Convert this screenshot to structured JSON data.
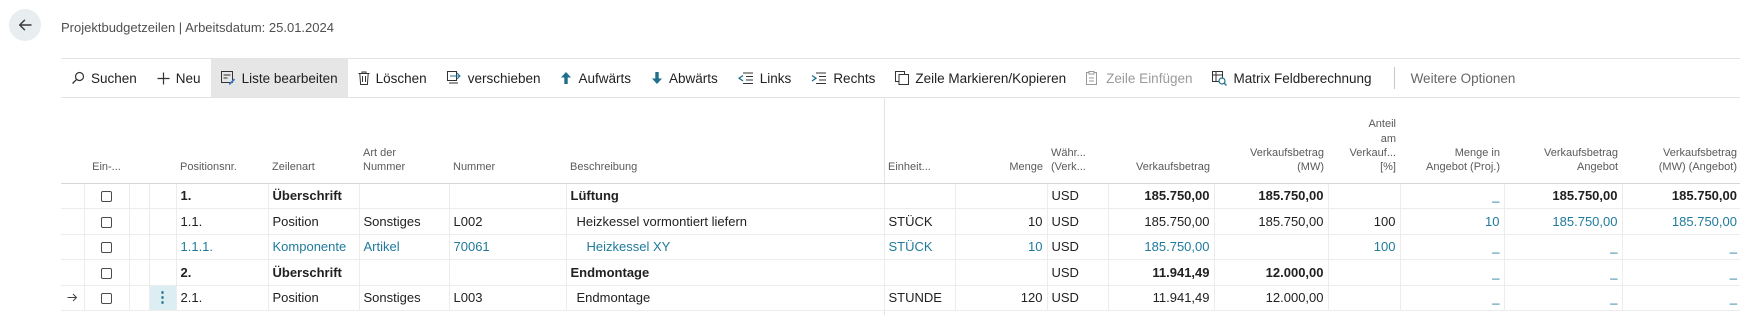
{
  "header": {
    "title": "Projektbudgetzeilen | Arbeitsdatum: 25.01.2024"
  },
  "actions": {
    "search": "Suchen",
    "new": "Neu",
    "edit_list": "Liste bearbeiten",
    "delete": "Löschen",
    "move": "verschieben",
    "up": "Aufwärts",
    "down": "Abwärts",
    "left": "Links",
    "right": "Rechts",
    "mark_copy": "Zeile Markieren/Kopieren",
    "insert_line": "Zeile Einfügen",
    "matrix": "Matrix Feldberechnung",
    "more": "Weitere Optionen"
  },
  "columns": {
    "ein": "Ein-...",
    "pos": "Positionsnr.",
    "zeilenart": "Zeilenart",
    "artnr_1": "Art der",
    "artnr_2": "Nummer",
    "nummer": "Nummer",
    "beschr": "Beschreibung",
    "einheit": "Einheit...",
    "menge": "Menge",
    "waehr_1": "Währ...",
    "waehr_2": "(Verk...",
    "vk": "Verkaufsbetrag",
    "vkmw_1": "Verkaufsbetrag",
    "vkmw_2": "(MW)",
    "anteil_1": "Anteil",
    "anteil_2": "am",
    "anteil_3": "Verkauf...",
    "anteil_4": "[%]",
    "mengeang_1": "Menge in",
    "mengeang_2": "Angebot (Proj.)",
    "vkang_1": "Verkaufsbetrag",
    "vkang_2": "Angebot",
    "vkmwang_1": "Verkaufsbetrag",
    "vkmwang_2": "(MW) (Angebot)"
  },
  "rows": [
    {
      "pos": "1.",
      "zeilenart": "Überschrift",
      "artnr": "",
      "nummer": "",
      "beschr": "Lüftung",
      "einheit": "",
      "menge": "",
      "waehr": "USD",
      "vk": "185.750,00",
      "vkmw": "185.750,00",
      "anteil": "",
      "mengeang": "_",
      "vkang": "185.750,00",
      "vkmwang": "185.750,00"
    },
    {
      "pos": "1.1.",
      "zeilenart": "Position",
      "artnr": "Sonstiges",
      "nummer": "L002",
      "beschr": "Heizkessel vormontiert liefern",
      "einheit": "STÜCK",
      "menge": "10",
      "waehr": "USD",
      "vk": "185.750,00",
      "vkmw": "185.750,00",
      "anteil": "100",
      "mengeang": "10",
      "vkang": "185.750,00",
      "vkmwang": "185.750,00"
    },
    {
      "pos": "1.1.1.",
      "zeilenart": "Komponente",
      "artnr": "Artikel",
      "nummer": "70061",
      "beschr": "Heizkessel XY",
      "einheit": "STÜCK",
      "menge": "10",
      "waehr": "USD",
      "vk": "185.750,00",
      "vkmw": "",
      "anteil": "100",
      "mengeang": "_",
      "vkang": "_",
      "vkmwang": "_"
    },
    {
      "pos": "2.",
      "zeilenart": "Überschrift",
      "artnr": "",
      "nummer": "",
      "beschr": "Endmontage",
      "einheit": "",
      "menge": "",
      "waehr": "USD",
      "vk": "11.941,49",
      "vkmw": "12.000,00",
      "anteil": "",
      "mengeang": "_",
      "vkang": "_",
      "vkmwang": "_"
    },
    {
      "pos": "2.1.",
      "zeilenart": "Position",
      "artnr": "Sonstiges",
      "nummer": "L003",
      "beschr": "Endmontage",
      "einheit": "STUNDE",
      "menge": "120",
      "waehr": "USD",
      "vk": "11.941,49",
      "vkmw": "12.000,00",
      "anteil": "",
      "mengeang": "_",
      "vkang": "_",
      "vkmwang": "_"
    }
  ],
  "colors": {
    "link": "#1f7a9c",
    "active_action_bg": "#e6e6e6",
    "selected_menu_cell": "#ddeef2"
  }
}
